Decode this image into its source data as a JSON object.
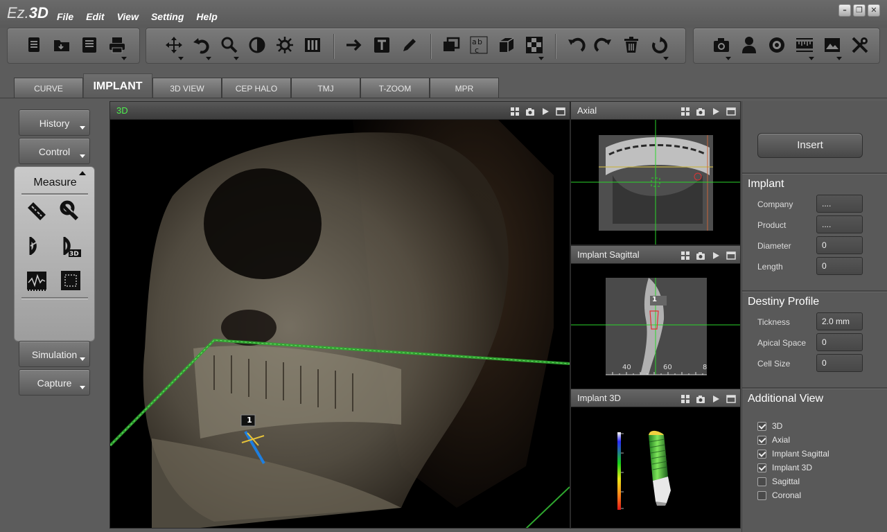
{
  "app": {
    "logo_prefix": "Ez.",
    "logo_suffix": "3D"
  },
  "menu": [
    "File",
    "Edit",
    "View",
    "Setting",
    "Help"
  ],
  "window_controls": [
    "minimize",
    "restore",
    "close"
  ],
  "toolbar_icons": [
    "new-document-icon",
    "open-folder-icon",
    "save-icon",
    "print-icon",
    "move-icon",
    "rotate-icon",
    "zoom-icon",
    "contrast-icon",
    "brightness-icon",
    "columns-icon",
    "arrow-icon",
    "text-icon",
    "pen-icon",
    "layers-icon",
    "abc-icon",
    "cube-icon",
    "checker-icon",
    "undo-icon",
    "redo-icon",
    "trash-icon",
    "reset-icon",
    "camera-icon",
    "patient-icon",
    "disc-icon",
    "ruler-bar-icon",
    "image-icon",
    "tools-icon"
  ],
  "tabs": [
    "CURVE",
    "IMPLANT",
    "3D VIEW",
    "CEP HALO",
    "TMJ",
    "T-ZOOM",
    "MPR"
  ],
  "active_tab": "IMPLANT",
  "left_panel": {
    "history": "History",
    "control": "Control",
    "measure": "Measure",
    "simulation": "Simulation",
    "capture": "Capture"
  },
  "measure_tools": [
    "ruler-icon",
    "tape-measure-icon",
    "angle-icon",
    "angle-3d-icon",
    "profile-icon",
    "area-icon"
  ],
  "viewports": {
    "main": {
      "title": "3D",
      "implant_label": "1"
    },
    "axial": {
      "title": "Axial"
    },
    "sagittal": {
      "title": "Implant Sagittal",
      "implant_label": "1",
      "ticks": [
        "40",
        "60",
        "8"
      ]
    },
    "implant3d": {
      "title": "Implant 3D"
    }
  },
  "right_panel": {
    "insert": "Insert",
    "implant": {
      "heading": "Implant",
      "fields": [
        {
          "label": "Company",
          "value": "...."
        },
        {
          "label": "Product",
          "value": "...."
        },
        {
          "label": "Diameter",
          "value": "0"
        },
        {
          "label": "Length",
          "value": "0"
        }
      ]
    },
    "destiny": {
      "heading": "Destiny Profile",
      "fields": [
        {
          "label": "Tickness",
          "value": "2.0 mm"
        },
        {
          "label": "Apical Space",
          "value": "0"
        },
        {
          "label": "Cell Size",
          "value": "0"
        }
      ]
    },
    "additional": {
      "heading": "Additional View",
      "items": [
        {
          "label": "3D",
          "checked": true
        },
        {
          "label": "Axial",
          "checked": true
        },
        {
          "label": "Implant Sagittal",
          "checked": true
        },
        {
          "label": "Implant 3D",
          "checked": true
        },
        {
          "label": "Sagittal",
          "checked": false
        },
        {
          "label": "Coronal",
          "checked": false
        }
      ]
    }
  },
  "colors": {
    "green_line": "#3cc43c",
    "title_green": "#4ef04e",
    "crosshair": "#2bd62b"
  }
}
